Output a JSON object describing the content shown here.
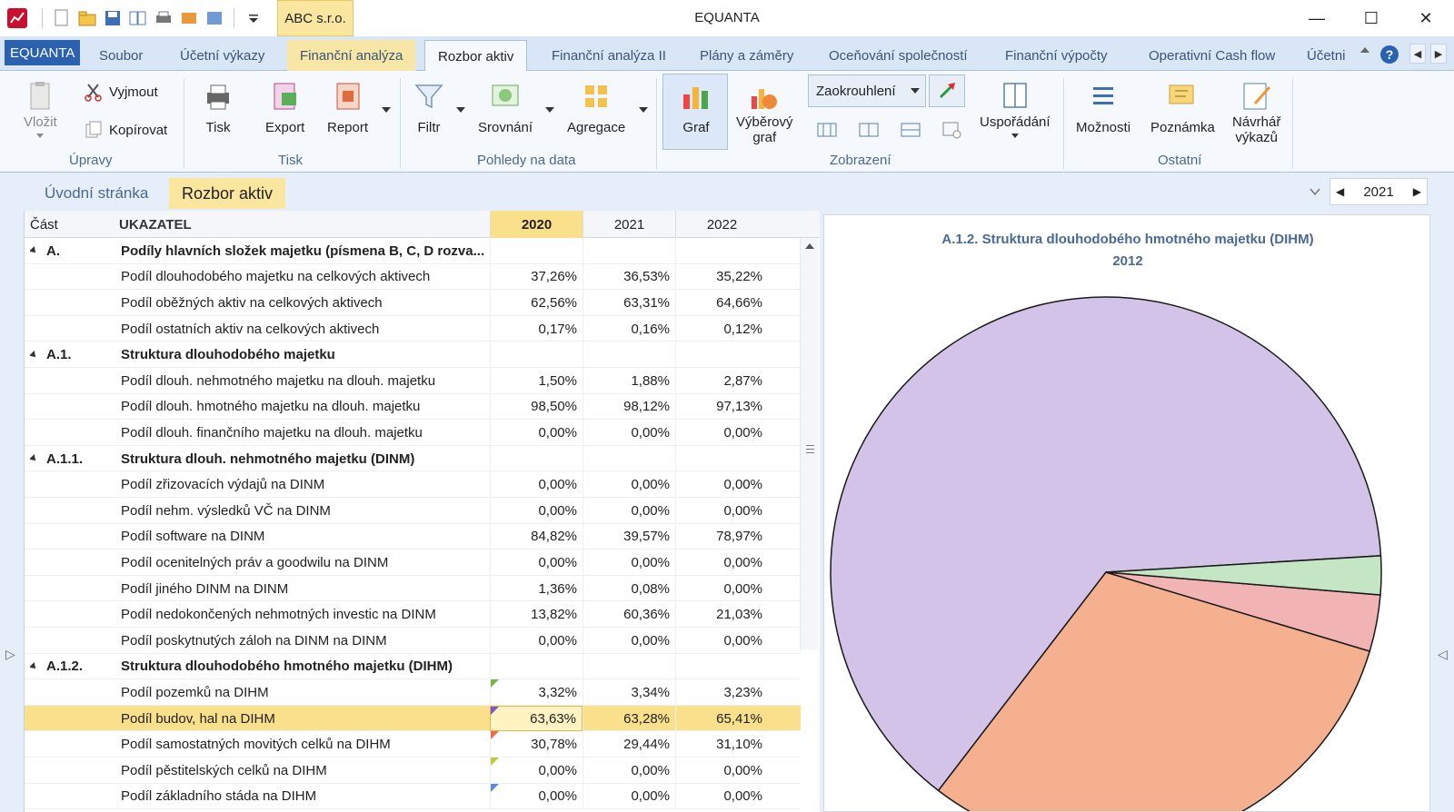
{
  "window": {
    "title": "EQUANTA",
    "company": "ABC s.r.o.",
    "minimize": "—",
    "maximize": "☐",
    "close": "✕"
  },
  "ribbon_tabs": [
    {
      "label": "EQUANTA"
    },
    {
      "label": "Soubor"
    },
    {
      "label": "Účetní výkazy"
    },
    {
      "label": "Finanční analýza"
    },
    {
      "label": "Rozbor aktiv"
    },
    {
      "label": "Finanční analýza II"
    },
    {
      "label": "Plány a záměry"
    },
    {
      "label": "Oceňování společností"
    },
    {
      "label": "Finanční výpočty"
    },
    {
      "label": "Operativní Cash flow"
    },
    {
      "label": "Účetni"
    }
  ],
  "ribbon": {
    "upravy": {
      "vlozit": "Vložit",
      "vyjmout": "Vyjmout",
      "kopirovat": "Kopírovat",
      "group": "Úpravy"
    },
    "tisk": {
      "tisk": "Tisk",
      "export": "Export",
      "report": "Report",
      "group": "Tisk"
    },
    "pohledy": {
      "filtr": "Filtr",
      "srovnani": "Srovnání",
      "agregace": "Agregace",
      "group": "Pohledy na data"
    },
    "zobrazeni": {
      "graf": "Graf",
      "vyberovy": "Výběrový",
      "graf2": "graf",
      "zaokrouhleni": "Zaokrouhlení",
      "usporadani": "Uspořádání",
      "group": "Zobrazení"
    },
    "ostatni": {
      "moznosti": "Možnosti",
      "poznamka": "Poznámka",
      "navrhar1": "Návrhář",
      "navrhar2": "výkazů",
      "group": "Ostatní"
    }
  },
  "doc_tabs": [
    {
      "label": "Úvodní stránka"
    },
    {
      "label": "Rozbor aktiv"
    }
  ],
  "year_selector": {
    "value": "2021"
  },
  "grid": {
    "headers": {
      "part": "Část",
      "name": "UKAZATEL",
      "y1": "2020",
      "y2": "2021",
      "y3": "2022"
    },
    "rows": [
      {
        "part": "A.",
        "name": "Podíly hlavních složek majetku (písmena B, C, D rozva...",
        "v1": "",
        "v2": "",
        "v3": "",
        "group": true
      },
      {
        "part": "",
        "name": "Podíl dlouhodobého majetku na celkových aktivech",
        "v1": "37,26%",
        "v2": "36,53%",
        "v3": "35,22%"
      },
      {
        "part": "",
        "name": "Podíl oběžných aktiv na celkových aktivech",
        "v1": "62,56%",
        "v2": "63,31%",
        "v3": "64,66%"
      },
      {
        "part": "",
        "name": "Podíl ostatních aktiv na celkových aktivech",
        "v1": "0,17%",
        "v2": "0,16%",
        "v3": "0,12%"
      },
      {
        "part": "A.1.",
        "name": "Struktura dlouhodobého majetku",
        "v1": "",
        "v2": "",
        "v3": "",
        "group": true
      },
      {
        "part": "",
        "name": "Podíl dlouh. nehmotného majetku na dlouh. majetku",
        "v1": "1,50%",
        "v2": "1,88%",
        "v3": "2,87%"
      },
      {
        "part": "",
        "name": "Podíl dlouh. hmotného majetku na dlouh. majetku",
        "v1": "98,50%",
        "v2": "98,12%",
        "v3": "97,13%"
      },
      {
        "part": "",
        "name": "Podíl dlouh. finančního majetku na dlouh. majetku",
        "v1": "0,00%",
        "v2": "0,00%",
        "v3": "0,00%"
      },
      {
        "part": "A.1.1.",
        "name": "Struktura dlouh. nehmotného majetku (DINM)",
        "v1": "",
        "v2": "",
        "v3": "",
        "group": true
      },
      {
        "part": "",
        "name": "Podíl zřizovacích výdajů na DINM",
        "v1": "0,00%",
        "v2": "0,00%",
        "v3": "0,00%"
      },
      {
        "part": "",
        "name": "Podíl nehm. výsledků VČ na DINM",
        "v1": "0,00%",
        "v2": "0,00%",
        "v3": "0,00%"
      },
      {
        "part": "",
        "name": "Podíl software na DINM",
        "v1": "84,82%",
        "v2": "39,57%",
        "v3": "78,97%"
      },
      {
        "part": "",
        "name": "Podíl ocenitelných práv a goodwilu na DINM",
        "v1": "0,00%",
        "v2": "0,00%",
        "v3": "0,00%"
      },
      {
        "part": "",
        "name": "Podíl jiného DINM na DINM",
        "v1": "1,36%",
        "v2": "0,08%",
        "v3": "0,00%"
      },
      {
        "part": "",
        "name": "Podíl nedokončených nehmotných investic na DINM",
        "v1": "13,82%",
        "v2": "60,36%",
        "v3": "21,03%"
      },
      {
        "part": "",
        "name": "Podíl poskytnutých záloh na DINM na DINM",
        "v1": "0,00%",
        "v2": "0,00%",
        "v3": "0,00%"
      },
      {
        "part": "A.1.2.",
        "name": "Struktura dlouhodobého hmotného majetku (DIHM)",
        "v1": "",
        "v2": "",
        "v3": "",
        "group": true
      },
      {
        "part": "",
        "name": "Podíl pozemků na DIHM",
        "v1": "3,32%",
        "v2": "3,34%",
        "v3": "3,23%",
        "flag": "#7cb342"
      },
      {
        "part": "",
        "name": "Podíl budov, hal na DIHM",
        "v1": "63,63%",
        "v2": "63,28%",
        "v3": "65,41%",
        "flag": "#7e57c2",
        "selected": true
      },
      {
        "part": "",
        "name": "Podíl samostatných movitých celků na DIHM",
        "v1": "30,78%",
        "v2": "29,44%",
        "v3": "31,10%",
        "flag": "#ef6c4a"
      },
      {
        "part": "",
        "name": "Podíl pěstitelských celků na DIHM",
        "v1": "0,00%",
        "v2": "0,00%",
        "v3": "0,00%",
        "flag": "#c0ca33"
      },
      {
        "part": "",
        "name": "Podíl základního stáda na DIHM",
        "v1": "0,00%",
        "v2": "0,00%",
        "v3": "0,00%",
        "flag": "#5c8ad6"
      }
    ]
  },
  "chart_data": {
    "type": "pie",
    "title": "A.1.2. Struktura dlouhodobého hmotného majetku (DIHM)",
    "subtitle": "2012",
    "slices": [
      {
        "label": "Podíl budov, hal na DIHM",
        "value": 63.63,
        "color": "#d4c3e8"
      },
      {
        "label": "Podíl samostatných movitých celků na DIHM",
        "value": 30.78,
        "color": "#f4b08f"
      },
      {
        "label": "Podíl pozemků na DIHM",
        "value": 3.32,
        "color": "#f2b3b5"
      },
      {
        "label": "Podíl ostatních",
        "value": 2.27,
        "color": "#c4e6c4"
      }
    ]
  }
}
